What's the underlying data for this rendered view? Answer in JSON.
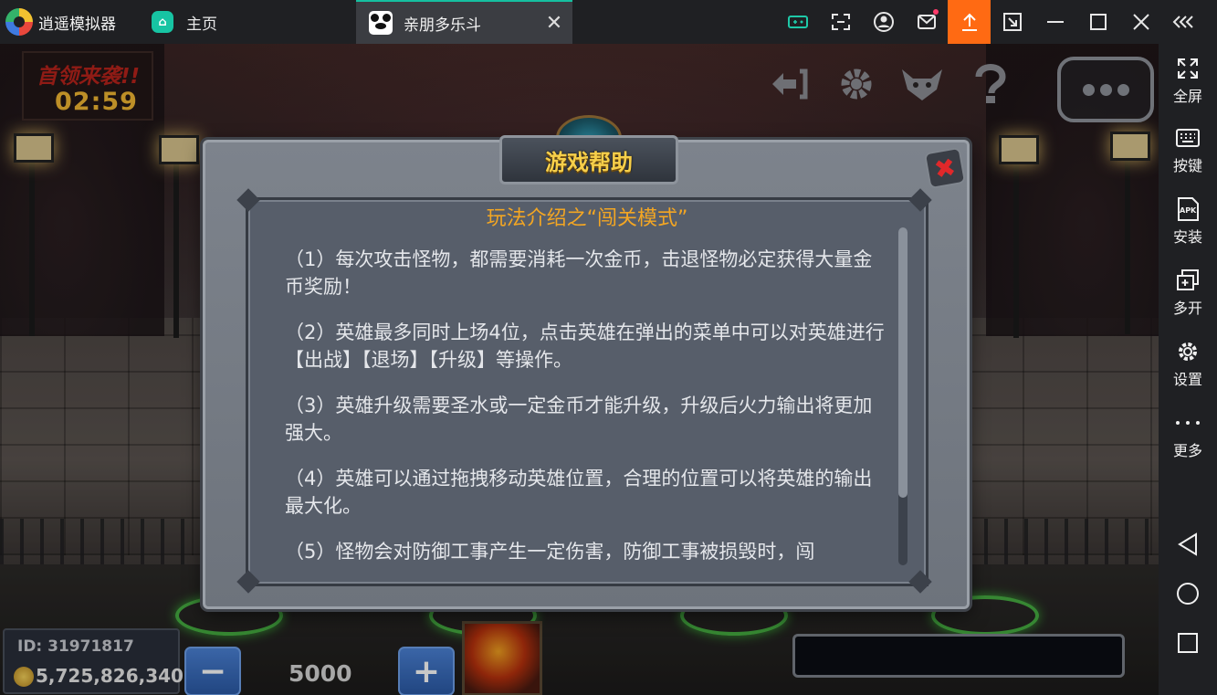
{
  "titlebar": {
    "app_name": "逍遥模拟器",
    "home_tab": "主页",
    "home_icon": "home-icon",
    "active_tab": "亲朋多乐斗",
    "active_tab_close": "✕",
    "toolbar_icons": [
      "gamepad-icon",
      "screenshot-icon",
      "user-icon",
      "mail-icon",
      "upload-icon",
      "fit-screen-icon",
      "minimize-icon",
      "maximize-icon",
      "close-icon",
      "collapse-icon"
    ],
    "accent_color": "#16c0a0",
    "upload_color": "#ff6a13"
  },
  "sidebar": {
    "items": [
      {
        "label": "全屏",
        "icon": "fullscreen-icon"
      },
      {
        "label": "按键",
        "icon": "keyboard-icon"
      },
      {
        "label": "安装",
        "icon": "apk-icon"
      },
      {
        "label": "多开",
        "icon": "multi-instance-icon"
      },
      {
        "label": "设置",
        "icon": "settings-icon"
      },
      {
        "label": "更多",
        "icon": "more-icon"
      }
    ],
    "nav": [
      "back-icon",
      "home-icon",
      "recent-apps-icon"
    ]
  },
  "game": {
    "banner_title": "首领来袭!!",
    "countdown": "02:59",
    "player_id": "ID: 31971817",
    "coins": "5,725,826,340",
    "bet_value": "5000",
    "minus": "−",
    "plus": "+"
  },
  "dialog": {
    "title": "游戏帮助",
    "close": "✖",
    "subtitle": "玩法介绍之“闯关模式”",
    "paragraphs": [
      "（1）每次攻击怪物，都需要消耗一次金币，击退怪物必定获得大量金币奖励！",
      "（2）英雄最多同时上场4位，点击英雄在弹出的菜单中可以对英雄进行【出战】【退场】【升级】等操作。",
      "（3）英雄升级需要圣水或一定金币才能升级，升级后火力输出将更加强大。",
      "（4）英雄可以通过拖拽移动英雄位置，合理的位置可以将英雄的输出最大化。",
      "（5）怪物会对防御工事产生一定伤害，防御工事被损毁时，闯"
    ]
  }
}
